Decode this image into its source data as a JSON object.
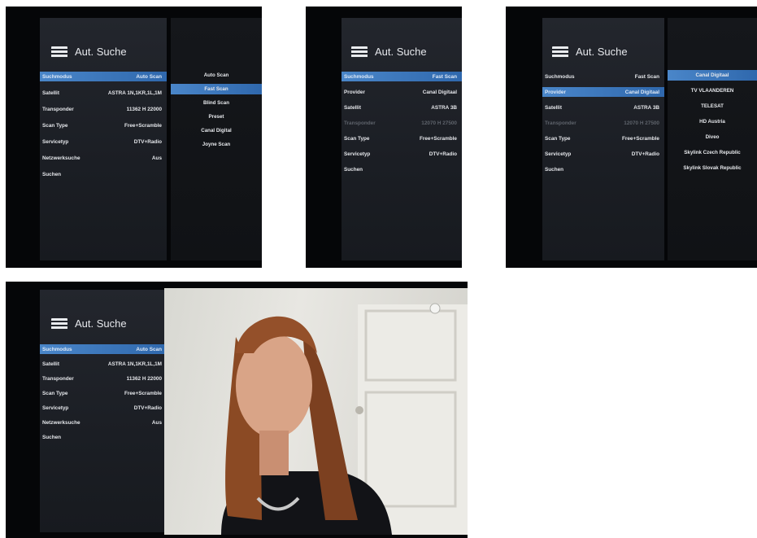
{
  "menu_title": "Aut. Suche",
  "screens": [
    {
      "rows": [
        {
          "label": "Suchmodus",
          "value": "Auto Scan",
          "state": "selected"
        },
        {
          "label": "Satellit",
          "value": "ASTRA 1N,1KR,1L,1M"
        },
        {
          "label": "Transponder",
          "value": "11362 H 22000"
        },
        {
          "label": "Scan Type",
          "value": "Free+Scramble"
        },
        {
          "label": "Servicetyp",
          "value": "DTV+Radio"
        },
        {
          "label": "Netzwerksuche",
          "value": "Aus"
        },
        {
          "label": "Suchen",
          "value": ""
        }
      ],
      "options": [
        {
          "label": "Auto Scan"
        },
        {
          "label": "Fast Scan",
          "state": "selected"
        },
        {
          "label": "Blind Scan"
        },
        {
          "label": "Preset"
        },
        {
          "label": "Canal Digital"
        },
        {
          "label": "Joyne Scan"
        }
      ]
    },
    {
      "rows": [
        {
          "label": "Suchmodus",
          "value": "Fast Scan",
          "state": "selected"
        },
        {
          "label": "Provider",
          "value": "Canal Digitaal"
        },
        {
          "label": "Satellit",
          "value": "ASTRA 3B"
        },
        {
          "label": "Transponder",
          "value": "12070 H 27500",
          "state": "disabled"
        },
        {
          "label": "Scan Type",
          "value": "Free+Scramble"
        },
        {
          "label": "Servicetyp",
          "value": "DTV+Radio"
        },
        {
          "label": "Suchen",
          "value": ""
        }
      ]
    },
    {
      "rows": [
        {
          "label": "Suchmodus",
          "value": "Fast Scan"
        },
        {
          "label": "Provider",
          "value": "Canal Digitaal",
          "state": "selected"
        },
        {
          "label": "Satellit",
          "value": "ASTRA 3B"
        },
        {
          "label": "Transponder",
          "value": "12070 H 27500",
          "state": "disabled"
        },
        {
          "label": "Scan Type",
          "value": "Free+Scramble"
        },
        {
          "label": "Servicetyp",
          "value": "DTV+Radio"
        },
        {
          "label": "Suchen",
          "value": ""
        }
      ],
      "options": [
        {
          "label": "Canal Digitaal",
          "state": "selected"
        },
        {
          "label": "TV VLAANDEREN"
        },
        {
          "label": "TELESAT"
        },
        {
          "label": "HD Austria"
        },
        {
          "label": "Diveo"
        },
        {
          "label": "Skylink Czech Republic"
        },
        {
          "label": "Skylink Slovak Republic"
        }
      ]
    },
    {
      "rows": [
        {
          "label": "Suchmodus",
          "value": "Auto Scan",
          "state": "selected"
        },
        {
          "label": "Satellit",
          "value": "ASTRA 1N,1KR,1L,1M"
        },
        {
          "label": "Transponder",
          "value": "11362 H 22000"
        },
        {
          "label": "Scan Type",
          "value": "Free+Scramble"
        },
        {
          "label": "Servicetyp",
          "value": "DTV+Radio"
        },
        {
          "label": "Netzwerksuche",
          "value": "Aus"
        },
        {
          "label": "Suchen",
          "value": ""
        }
      ]
    }
  ]
}
